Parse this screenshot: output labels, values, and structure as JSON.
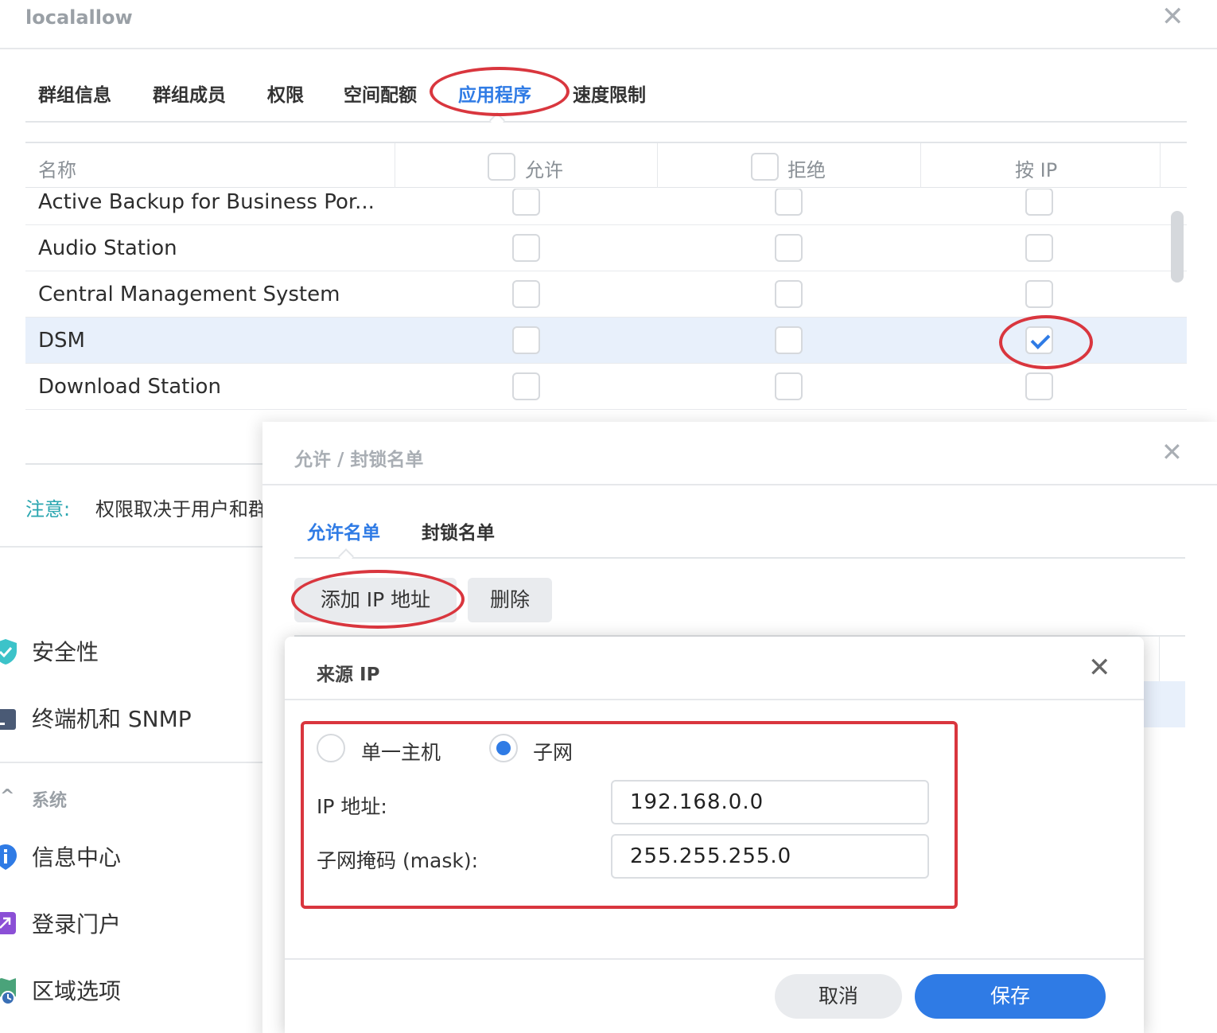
{
  "window": {
    "title": "localallow",
    "close_glyph": "✕"
  },
  "tabs": [
    {
      "label": "群组信息"
    },
    {
      "label": "群组成员"
    },
    {
      "label": "权限"
    },
    {
      "label": "空间配额"
    },
    {
      "label": "应用程序",
      "active": true
    },
    {
      "label": "速度限制"
    }
  ],
  "grid": {
    "columns": {
      "name": "名称",
      "allow": "允许",
      "deny": "拒绝",
      "by_ip": "按 IP"
    },
    "rows": [
      {
        "name": "Active Backup for Business Por...",
        "allow": false,
        "deny": false,
        "by_ip": false
      },
      {
        "name": "Audio Station",
        "allow": false,
        "deny": false,
        "by_ip": false
      },
      {
        "name": "Central Management System",
        "allow": false,
        "deny": false,
        "by_ip": false
      },
      {
        "name": "DSM",
        "allow": false,
        "deny": false,
        "by_ip": true,
        "selected": true
      },
      {
        "name": "Download Station",
        "allow": false,
        "deny": false,
        "by_ip": false
      }
    ]
  },
  "note": {
    "label": "注意:",
    "text": "权限取决于用户和群组"
  },
  "sidebar": {
    "items": [
      {
        "label": "安全性",
        "icon": "shield-icon",
        "color": "#3cc3c9"
      },
      {
        "label": "终端机和 SNMP",
        "icon": "terminal-icon",
        "color": "#4a5a75"
      },
      {
        "label": "信息中心",
        "icon": "info-icon",
        "color": "#2f7be5"
      },
      {
        "label": "登录门户",
        "icon": "portal-icon",
        "color": "#8b4fd6"
      },
      {
        "label": "区域选项",
        "icon": "region-icon",
        "color": "#4aa37a"
      }
    ],
    "section": {
      "label": "系统",
      "chevron": "^"
    }
  },
  "allow_block_dialog": {
    "title": "允许 / 封锁名单",
    "close_glyph": "✕",
    "tabs": [
      {
        "label": "允许名单",
        "active": true
      },
      {
        "label": "封锁名单"
      }
    ],
    "add_button": "添加 IP 地址",
    "delete_button": "删除"
  },
  "source_ip_dialog": {
    "title": "来源 IP",
    "close_glyph": "✕",
    "radio_single": "单一主机",
    "radio_subnet": "子网",
    "selected": "subnet",
    "ip_label": "IP 地址:",
    "ip_value": "192.168.0.0",
    "mask_label": "子网掩码 (mask):",
    "mask_value": "255.255.255.0",
    "cancel": "取消",
    "save": "保存"
  },
  "colors": {
    "accent": "#2f7be5",
    "annotation": "#d9363e",
    "note": "#2aa6b0"
  }
}
